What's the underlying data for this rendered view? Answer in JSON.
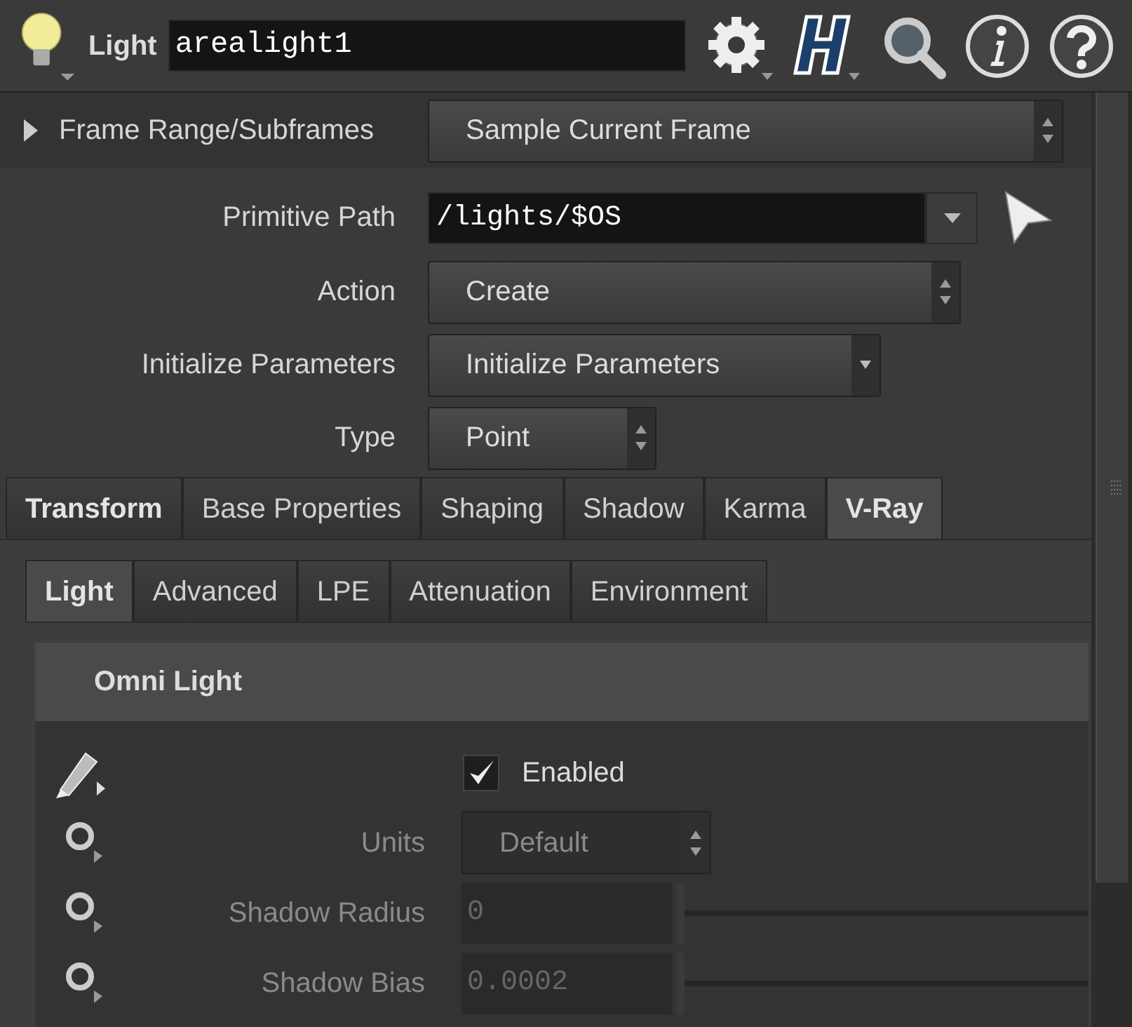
{
  "header": {
    "node_type": "Light",
    "node_name": "arealight1"
  },
  "frame_range": {
    "label": "Frame Range/Subframes",
    "expanded": false,
    "value": "Sample Current Frame"
  },
  "parameters": [
    {
      "kind": "path",
      "label": "Primitive Path",
      "value": "/lights/$OS"
    },
    {
      "kind": "menu",
      "label": "Action",
      "value": "Create",
      "stepper": true
    },
    {
      "kind": "menu",
      "label": "Initialize Parameters",
      "value": "Initialize Parameters",
      "stepper": false
    },
    {
      "kind": "menu",
      "label": "Type",
      "value": "Point",
      "stepper": true
    }
  ],
  "tabs": [
    {
      "label": "Transform",
      "selected": false,
      "modified": true
    },
    {
      "label": "Base Properties",
      "selected": false,
      "modified": false
    },
    {
      "label": "Shaping",
      "selected": false,
      "modified": false
    },
    {
      "label": "Shadow",
      "selected": false,
      "modified": false
    },
    {
      "label": "Karma",
      "selected": false,
      "modified": false
    },
    {
      "label": "V-Ray",
      "selected": true,
      "modified": true
    }
  ],
  "subtabs": [
    {
      "label": "Light",
      "selected": true,
      "modified": true
    },
    {
      "label": "Advanced",
      "selected": false,
      "modified": false
    },
    {
      "label": "LPE",
      "selected": false,
      "modified": false
    },
    {
      "label": "Attenuation",
      "selected": false,
      "modified": false
    },
    {
      "label": "Environment",
      "selected": false,
      "modified": false
    }
  ],
  "section": {
    "title": "Omni Light",
    "rows": [
      {
        "kind": "checkbox",
        "label": "Enabled",
        "checked": true,
        "disabled": false,
        "modified": true
      },
      {
        "kind": "menu",
        "label": "Units",
        "value": "Default",
        "disabled": true,
        "modified": false
      },
      {
        "kind": "slider",
        "label": "Shadow Radius",
        "value": "0",
        "level": 0,
        "disabled": true,
        "modified": false
      },
      {
        "kind": "slider",
        "label": "Shadow Bias",
        "value": "0.0002",
        "level": 0,
        "disabled": true,
        "modified": false
      }
    ]
  }
}
